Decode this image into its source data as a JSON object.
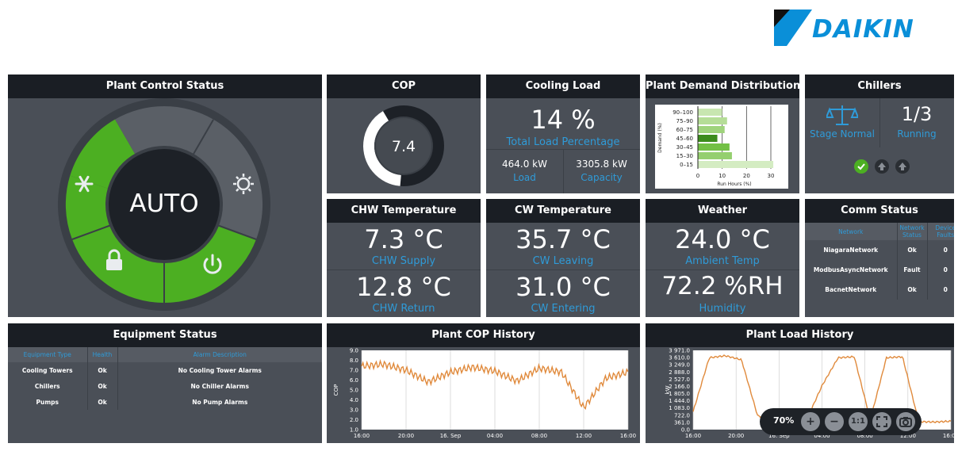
{
  "brand": {
    "logo_text": "DAIKIN"
  },
  "plant_control": {
    "title": "Plant Control Status",
    "mode": "AUTO"
  },
  "cop": {
    "title": "COP",
    "value": "7.4",
    "gauge_fraction": 0.4
  },
  "cooling_load": {
    "title": "Cooling Load",
    "percent": "14 %",
    "percent_label": "Total Load Percentage",
    "load_value": "464.0 kW",
    "load_label": "Load",
    "capacity_value": "3305.8 kW",
    "capacity_label": "Capacity"
  },
  "demand": {
    "title": "Plant Demand Distribution",
    "ylabel": "Demand (%)",
    "xlabel": "Run Hours (%)",
    "categories": [
      "90–100",
      "75–90",
      "60–75",
      "45–60",
      "30–45",
      "15–30",
      "0–15"
    ],
    "values": [
      10,
      12,
      11,
      8,
      13,
      14,
      31
    ],
    "x_ticks": [
      "0",
      "10",
      "20",
      "30"
    ],
    "xlim": [
      0,
      30
    ]
  },
  "chillers": {
    "title": "Chillers",
    "stage_label": "Stage Normal",
    "running_value": "1/3",
    "running_label": "Running"
  },
  "chw": {
    "title": "CHW Temperature",
    "supply_value": "7.3 °C",
    "supply_label": "CHW Supply",
    "return_value": "12.8 °C",
    "return_label": "CHW Return"
  },
  "cw": {
    "title": "CW Temperature",
    "leaving_value": "35.7 °C",
    "leaving_label": "CW Leaving",
    "entering_value": "31.0 °C",
    "entering_label": "CW Entering"
  },
  "weather": {
    "title": "Weather",
    "temp_value": "24.0 °C",
    "temp_label": "Ambient Temp",
    "humidity_value": "72.2 %RH",
    "humidity_label": "Humidity"
  },
  "comm": {
    "title": "Comm Status",
    "headers": [
      "Network",
      "Network Status",
      "Device Faults"
    ],
    "rows": [
      [
        "NiagaraNetwork",
        "Ok",
        "0"
      ],
      [
        "ModbusAsyncNetwork",
        "Fault",
        "0"
      ],
      [
        "BacnetNetwork",
        "Ok",
        "0"
      ]
    ]
  },
  "equipment": {
    "title": "Equipment Status",
    "headers": [
      "Equipment Type",
      "Health",
      "Alarm Description"
    ],
    "rows": [
      [
        "Cooling Towers",
        "Ok",
        "No Cooling Tower Alarms"
      ],
      [
        "Chillers",
        "Ok",
        "No Chiller Alarms"
      ],
      [
        "Pumps",
        "Ok",
        "No Pump Alarms"
      ]
    ]
  },
  "cop_history": {
    "title": "Plant COP History",
    "ylabel": "COP",
    "y_ticks": [
      "9.0",
      "8.0",
      "7.0",
      "6.0",
      "5.0",
      "4.0",
      "3.0",
      "2.0",
      "1.0"
    ],
    "x_ticks": [
      "16:00",
      "20:00",
      "16. Sep",
      "04:00",
      "08:00",
      "12:00",
      "16:00"
    ]
  },
  "load_history": {
    "title": "Plant Load History",
    "ylabel": "kW",
    "y_ticks": [
      "3 971.0",
      "3 610.0",
      "3 249.0",
      "2 888.0",
      "2 527.0",
      "2 166.0",
      "1 805.0",
      "1 444.0",
      "1 083.0",
      "722.0",
      "361.0",
      "0.0"
    ],
    "x_ticks": [
      "16:00",
      "20:00",
      "16. Sep",
      "04:00",
      "08:00",
      "12:00",
      "16:00"
    ]
  },
  "toolbar": {
    "zoom": "70%"
  },
  "colors": {
    "accent_green": "#4caf22",
    "accent_blue": "#2f9bd8",
    "line_orange": "#e08a3c"
  },
  "chart_data": [
    {
      "type": "bar",
      "title": "Plant Demand Distribution",
      "xlabel": "Run Hours (%)",
      "ylabel": "Demand (%)",
      "categories": [
        "90–100",
        "75–90",
        "60–75",
        "45–60",
        "30–45",
        "15–30",
        "0–15"
      ],
      "values": [
        10,
        12,
        11,
        8,
        13,
        14,
        31
      ],
      "xlim": [
        0,
        30
      ]
    },
    {
      "type": "line",
      "title": "Plant COP History",
      "ylabel": "COP",
      "ylim": [
        1.0,
        9.0
      ],
      "x": [
        "16:00",
        "18:00",
        "20:00",
        "22:00",
        "16. Sep",
        "02:00",
        "04:00",
        "06:00",
        "08:00",
        "10:00",
        "12:00",
        "14:00",
        "16:00"
      ],
      "values": [
        7.4,
        7.6,
        7.0,
        5.8,
        6.8,
        7.3,
        6.9,
        5.9,
        7.2,
        6.8,
        3.2,
        6.2,
        6.8
      ]
    },
    {
      "type": "line",
      "title": "Plant Load History",
      "ylabel": "kW",
      "ylim": [
        0.0,
        3971.0
      ],
      "x": [
        "16:00",
        "17:00",
        "18:00",
        "19:00",
        "20:00",
        "22:00",
        "16. Sep",
        "04:00",
        "06:00",
        "07:00",
        "08:00",
        "10:00",
        "12:00",
        "13:00",
        "14:00",
        "15:00",
        "16:00"
      ],
      "values": [
        900,
        3600,
        3700,
        3500,
        700,
        450,
        350,
        400,
        2200,
        3600,
        3650,
        500,
        3600,
        3650,
        400,
        380,
        420
      ]
    }
  ]
}
